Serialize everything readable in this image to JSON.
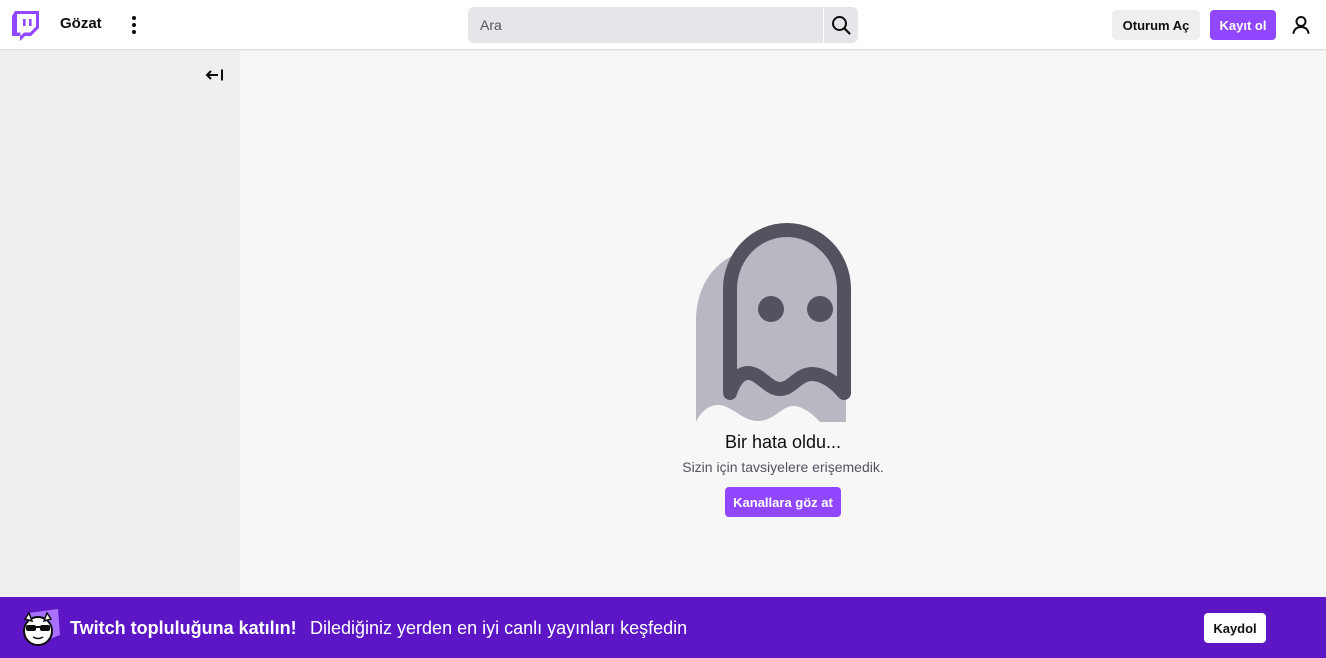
{
  "topnav": {
    "browse_label": "Gözat",
    "search_placeholder": "Ara",
    "login_label": "Oturum Aç",
    "signup_label": "Kayıt ol"
  },
  "error": {
    "title": "Bir hata oldu...",
    "subtitle": "Sizin için tavsiyelere erişemedik.",
    "button_label": "Kanallara göz at"
  },
  "banner": {
    "title": "Twitch topluluğuna katılın!",
    "text": "Dilediğiniz yerden en iyi canlı yayınları keşfedin",
    "button_label": "Kaydol"
  },
  "colors": {
    "brand_purple": "#9147ff",
    "banner_purple": "#5c16c5",
    "ghost_dark": "#53535f",
    "ghost_light": "#b8b8c2"
  },
  "icons": [
    "twitch-logo-icon",
    "more-vertical-icon",
    "search-icon",
    "user-icon",
    "collapse-left-icon",
    "ghost-illustration",
    "mascot-icon"
  ]
}
